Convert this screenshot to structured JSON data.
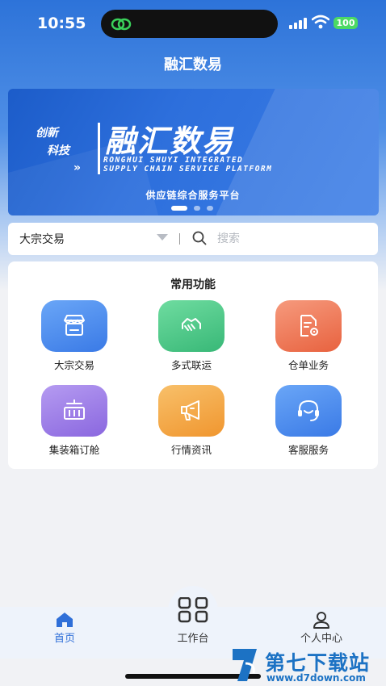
{
  "status_bar": {
    "time": "10:55",
    "battery": "100"
  },
  "app": {
    "title": "融汇数易"
  },
  "banner": {
    "slogan_line1": "创新",
    "slogan_line2": "科技",
    "brand_name": "融汇数易",
    "english_line1": "RONGHUI SHUYI INTEGRATED",
    "english_line2": "SUPPLY CHAIN SERVICE PLATFORM",
    "subtitle": "供应链综合服务平台",
    "page_count": 3,
    "active_page": 1
  },
  "search": {
    "category": "大宗交易",
    "placeholder": "搜索"
  },
  "functions": {
    "title": "常用功能",
    "items": [
      {
        "label": "大宗交易",
        "icon": "store-icon",
        "color": "#4a8cf0"
      },
      {
        "label": "多式联运",
        "icon": "handshake-icon",
        "color": "#4fc98a"
      },
      {
        "label": "仓单业务",
        "icon": "document-gear-icon",
        "color": "#ef7a5c"
      },
      {
        "label": "集装箱订舱",
        "icon": "container-icon",
        "color": "#9f7ee8"
      },
      {
        "label": "行情资讯",
        "icon": "megaphone-icon",
        "color": "#f4a54a"
      },
      {
        "label": "客服服务",
        "icon": "customer-service-icon",
        "color": "#4a8cf0"
      }
    ]
  },
  "tabbar": {
    "tabs": [
      {
        "label": "首页",
        "icon": "home-icon",
        "active": true
      },
      {
        "label": "工作台",
        "icon": "grid-icon",
        "active": false
      },
      {
        "label": "个人中心",
        "icon": "user-icon",
        "active": false
      }
    ]
  },
  "watermark": {
    "name": "第七下载站",
    "url": "www.d7down.com"
  }
}
